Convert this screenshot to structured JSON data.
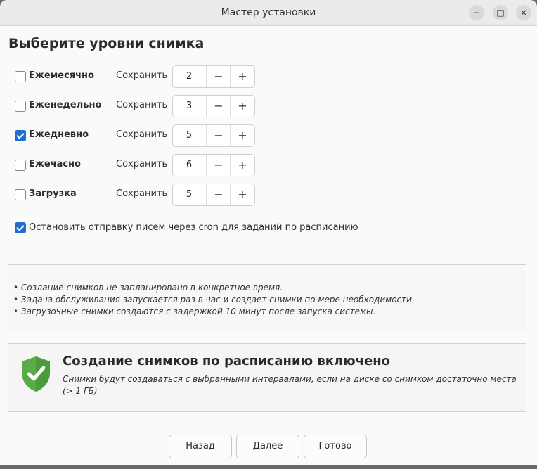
{
  "window": {
    "title": "Мастер установки",
    "controls": {
      "minimize": "−",
      "maximize": "□",
      "close": "×"
    }
  },
  "heading": "Выберите уровни снимка",
  "keep_label": "Сохранить",
  "levels": [
    {
      "label": "Ежемесячно",
      "checked": false,
      "keep": "2"
    },
    {
      "label": "Еженедельно",
      "checked": false,
      "keep": "3"
    },
    {
      "label": "Ежедневно",
      "checked": true,
      "keep": "5"
    },
    {
      "label": "Ежечасно",
      "checked": false,
      "keep": "6"
    },
    {
      "label": "Загрузка",
      "checked": false,
      "keep": "5"
    }
  ],
  "spin_symbols": {
    "minus": "−",
    "plus": "+"
  },
  "cron": {
    "label": "Остановить отправку писем через cron для заданий по расписанию",
    "checked": true
  },
  "notes": [
    "• Создание снимков не запланировано в конкретное время.",
    "• Задача обслуживания запускается раз в час и создает снимки по мере необходимости.",
    "• Загрузочные снимки создаются с задержкой 10 минут после запуска системы."
  ],
  "status": {
    "title": "Создание снимков по расписанию включено",
    "description": "Снимки будут создаваться с выбранными интервалами, если на диске со снимком достаточно места (> 1 ГБ)",
    "icon": "shield-check-icon",
    "icon_color": "#5aaa4a"
  },
  "buttons": {
    "back": "Назад",
    "next": "Далее",
    "done": "Готово"
  },
  "colors": {
    "accent": "#1f6fd1"
  }
}
